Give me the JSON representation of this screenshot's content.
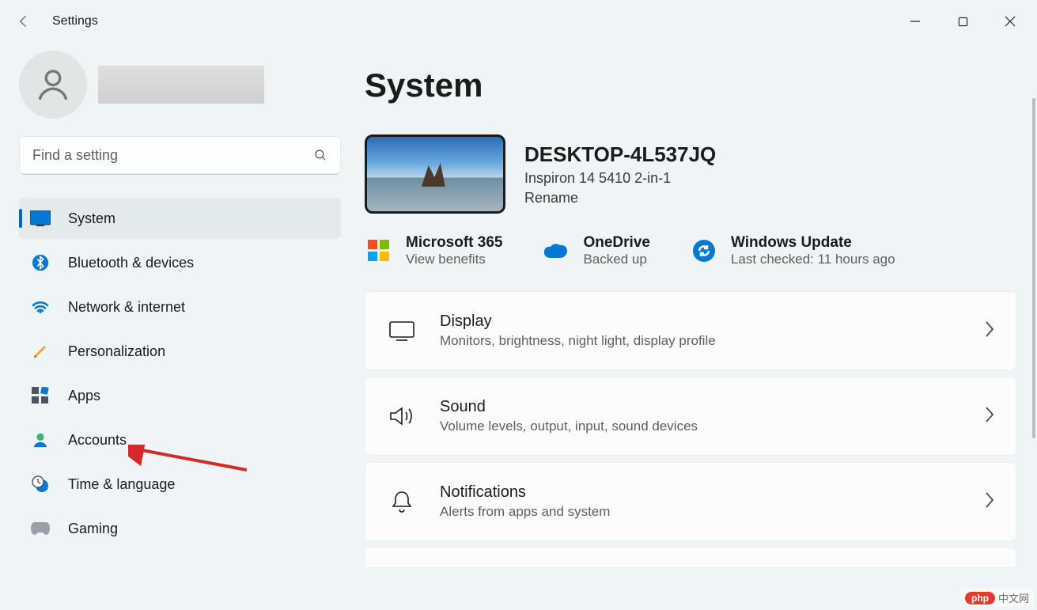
{
  "window": {
    "title": "Settings"
  },
  "user": {
    "name": ""
  },
  "search": {
    "placeholder": "Find a setting"
  },
  "nav": [
    {
      "id": "system",
      "label": "System",
      "active": true
    },
    {
      "id": "bluetooth",
      "label": "Bluetooth & devices",
      "active": false
    },
    {
      "id": "network",
      "label": "Network & internet",
      "active": false
    },
    {
      "id": "personalization",
      "label": "Personalization",
      "active": false
    },
    {
      "id": "apps",
      "label": "Apps",
      "active": false
    },
    {
      "id": "accounts",
      "label": "Accounts",
      "active": false
    },
    {
      "id": "time",
      "label": "Time & language",
      "active": false
    },
    {
      "id": "gaming",
      "label": "Gaming",
      "active": false
    }
  ],
  "page": {
    "title": "System",
    "device": {
      "name": "DESKTOP-4L537JQ",
      "model": "Inspiron 14 5410 2-in-1",
      "rename_label": "Rename"
    },
    "status": {
      "m365": {
        "title": "Microsoft 365",
        "sub": "View benefits"
      },
      "onedrive": {
        "title": "OneDrive",
        "sub": "Backed up"
      },
      "update": {
        "title": "Windows Update",
        "sub": "Last checked: 11 hours ago"
      }
    },
    "cards": [
      {
        "id": "display",
        "title": "Display",
        "sub": "Monitors, brightness, night light, display profile"
      },
      {
        "id": "sound",
        "title": "Sound",
        "sub": "Volume levels, output, input, sound devices"
      },
      {
        "id": "notifications",
        "title": "Notifications",
        "sub": "Alerts from apps and system"
      }
    ]
  },
  "watermark": {
    "badge": "php",
    "text": "中文网"
  }
}
